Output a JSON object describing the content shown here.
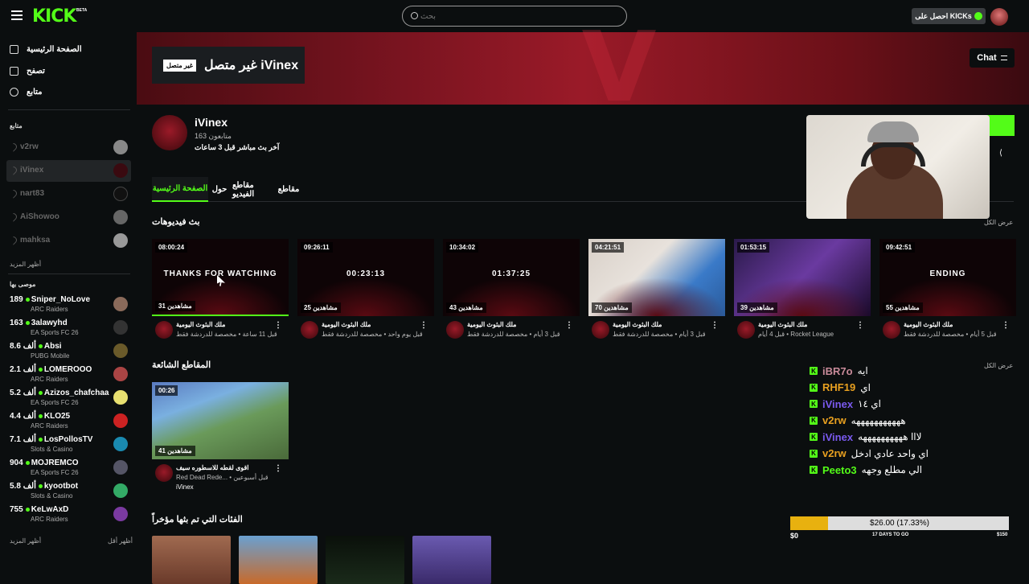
{
  "topbar": {
    "logo": "KICK",
    "logo_badge": "BETA",
    "search_placeholder": "بحث",
    "kicks_label": "احصل على KICKs"
  },
  "sidebar": {
    "nav": [
      {
        "label": "الصفحة الرئيسية",
        "icon": "home-icon"
      },
      {
        "label": "تصفح",
        "icon": "browse-icon"
      },
      {
        "label": "متابع",
        "icon": "heart-icon"
      }
    ],
    "following_header": "متابع",
    "following": [
      {
        "name": "v2rw"
      },
      {
        "name": "iVinex"
      },
      {
        "name": "nart83"
      },
      {
        "name": "AiShowoo"
      },
      {
        "name": "mahksa"
      }
    ],
    "show_more": "أظهر المزيد",
    "recommended_header": "موصى بها",
    "recommended": [
      {
        "viewers": "189",
        "name": "Sniper_NoLove",
        "category": "ARC Raiders",
        "color": "#8a6a5a"
      },
      {
        "viewers": "163",
        "name": "3alawyhd",
        "category": "EA Sports FC 26",
        "color": "#333"
      },
      {
        "viewers": "8.6 ألف",
        "name": "Absi",
        "category": "PUBG Mobile",
        "color": "#6a5a2a"
      },
      {
        "viewers": "2.1 ألف",
        "name": "LOMEROOO",
        "category": "ARC Raiders",
        "color": "#a44"
      },
      {
        "viewers": "5.2 ألف",
        "name": "Azizos_chafchaa",
        "category": "EA Sports FC 26",
        "color": "#e8e070"
      },
      {
        "viewers": "4.4 ألف",
        "name": "KLO25",
        "category": "ARC Raiders",
        "color": "#c22"
      },
      {
        "viewers": "7.1 ألف",
        "name": "LosPollosTV",
        "category": "Slots & Casino",
        "color": "#1a8ab0"
      },
      {
        "viewers": "904",
        "name": "MOJREMCO",
        "category": "EA Sports FC 26",
        "color": "#556"
      },
      {
        "viewers": "5.8 ألف",
        "name": "kyootbot",
        "category": "Slots & Casino",
        "color": "#3a6"
      },
      {
        "viewers": "755",
        "name": "KeLwAxD",
        "category": "ARC Raiders",
        "color": "#7a3aa0"
      }
    ],
    "show_more_2": "أظهر المزيد",
    "show_less": "أظهر أقل"
  },
  "channel": {
    "offline_badge": "غير متصل",
    "offline_title": "غير متصل iVinex",
    "chat_button": "Chat",
    "name": "iVinex",
    "followers": "163 متابعون",
    "last_live": "آخر بث مباشر قبل 3 ساعات",
    "tabs": [
      "الصفحة الرئيسية",
      "حول",
      "مقاطع الفيديو",
      "مقاطع"
    ]
  },
  "sections": {
    "vods_title": "بث فيديوهات",
    "view_all": "عرض الكل",
    "clips_title": "المقاطع الشائعة",
    "categories_title": "الفئات التي تم بثها مؤخراً"
  },
  "videos": [
    {
      "duration": "08:00:24",
      "views": "31 مشاهدين",
      "overlay": "THANKS FOR WATCHING",
      "title": "ملك البثوث اليومية",
      "meta": "قبل 11 ساعة • مخصصة للدردشة فقط"
    },
    {
      "duration": "09:26:11",
      "views": "25 مشاهدين",
      "overlay": "00:23:13",
      "title": "ملك البثوث اليومية",
      "meta": "قبل يوم واحد • مخصصة للدردشة فقط"
    },
    {
      "duration": "10:34:02",
      "views": "43 مشاهدين",
      "overlay": "01:37:25",
      "title": "ملك البثوث اليومية",
      "meta": "قبل 3 أيام • مخصصة للدردشة فقط"
    },
    {
      "duration": "04:21:51",
      "views": "70 مشاهدين",
      "overlay": "",
      "title": "ملك البثوث اليومية",
      "meta": "قبل 3 أيام • مخصصة للدردشة فقط"
    },
    {
      "duration": "01:53:15",
      "views": "39 مشاهدين",
      "overlay": "",
      "title": "ملك البثوث اليومية",
      "meta": "قبل 4 أيام • Rocket League"
    },
    {
      "duration": "09:42:51",
      "views": "55 مشاهدين",
      "overlay": "ENDING",
      "title": "ملك البثوث اليومية",
      "meta": "قبل 5 أيام • مخصصة للدردشة فقط"
    }
  ],
  "clip": {
    "duration": "00:26",
    "views": "41 مشاهدين",
    "title": "اقوى لقطه للاسطوره سيف",
    "meta": "Red Dead Rede... • قبل أسبوعين",
    "author": "iVinex"
  },
  "chat": [
    {
      "user": "iBR7o",
      "msg": "ايه",
      "color": "#c98b9a"
    },
    {
      "user": "RHF19",
      "msg": "اي",
      "color": "#e8a020"
    },
    {
      "user": "iVinex",
      "msg": "اي ١٤",
      "color": "#7a5af0"
    },
    {
      "user": "v2rw",
      "msg": "هههههههههههه",
      "color": "#e8a020"
    },
    {
      "user": "iVinex",
      "msg": "لااا ههههههههههه",
      "color": "#7a5af0"
    },
    {
      "user": "v2rw",
      "msg": "اي واحد عادي ادخل",
      "color": "#e8a020"
    },
    {
      "user": "Peeto3",
      "msg": "الي مطلع وجهه",
      "color": "#53fc18"
    }
  ],
  "goal": {
    "text": "$26.00 (17.33%)",
    "fraction": 0.1733,
    "min": "$0",
    "days": "17 DAYS TO GO",
    "max": "$150"
  },
  "colors": {
    "accent": "#53fc18",
    "background": "#0b0e0f"
  }
}
